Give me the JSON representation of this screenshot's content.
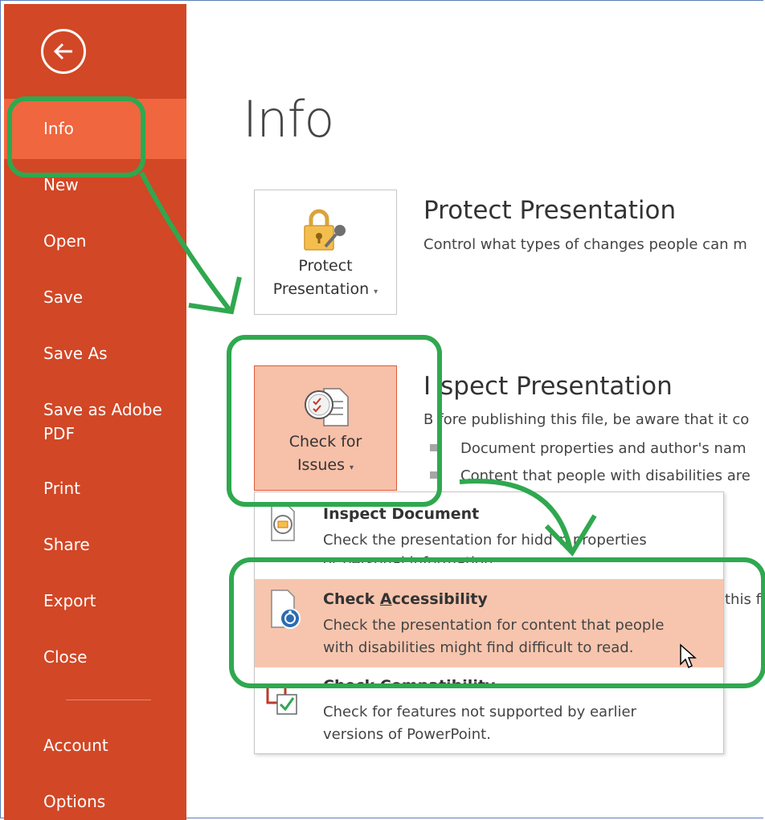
{
  "sidebar": {
    "items": [
      {
        "label": "Info"
      },
      {
        "label": "New"
      },
      {
        "label": "Open"
      },
      {
        "label": "Save"
      },
      {
        "label": "Save As"
      },
      {
        "label": "Save as Adobe"
      },
      {
        "label": "PDF"
      },
      {
        "label": "Print"
      },
      {
        "label": "Share"
      },
      {
        "label": "Export"
      },
      {
        "label": "Close"
      },
      {
        "label": "Account"
      },
      {
        "label": "Options"
      }
    ]
  },
  "main": {
    "title": "Info",
    "protect": {
      "button_line1": "Protect",
      "button_line2": "Presentation",
      "title": "Protect Presentation",
      "desc": "Control what types of changes people can m"
    },
    "inspect": {
      "button_line1": "Check for",
      "button_line2": "Issues",
      "title_a": "I",
      "title_b": "spect Presentation",
      "desc_a": "B",
      "desc_b": "fore publishing this file, be aware that it co",
      "bullet1": "Document properties and author's nam",
      "bullet2": "Content that people with disabilities are"
    },
    "partial_text": "this fi"
  },
  "menu": {
    "items": [
      {
        "title": "Inspect Document",
        "desc1": "Check the presentation for hidd",
        "desc1b": "n properties",
        "desc2": "or personal information."
      },
      {
        "title_a": "Check ",
        "title_u": "A",
        "title_b": "ccessibility",
        "desc1": "Check the presentation for content that people",
        "desc2": "with disabilities might find difficult to read."
      },
      {
        "title_a": "Check ",
        "title_u": "C",
        "title_b": "ompatibility",
        "desc1": "Check for features not supported by earlier",
        "desc2": "versions of PowerPoint."
      }
    ]
  },
  "colors": {
    "sidebar": "#d24726",
    "sidebar_active": "#f0663e",
    "highlight": "#f7c5ae",
    "annotation": "#2fa84f"
  }
}
